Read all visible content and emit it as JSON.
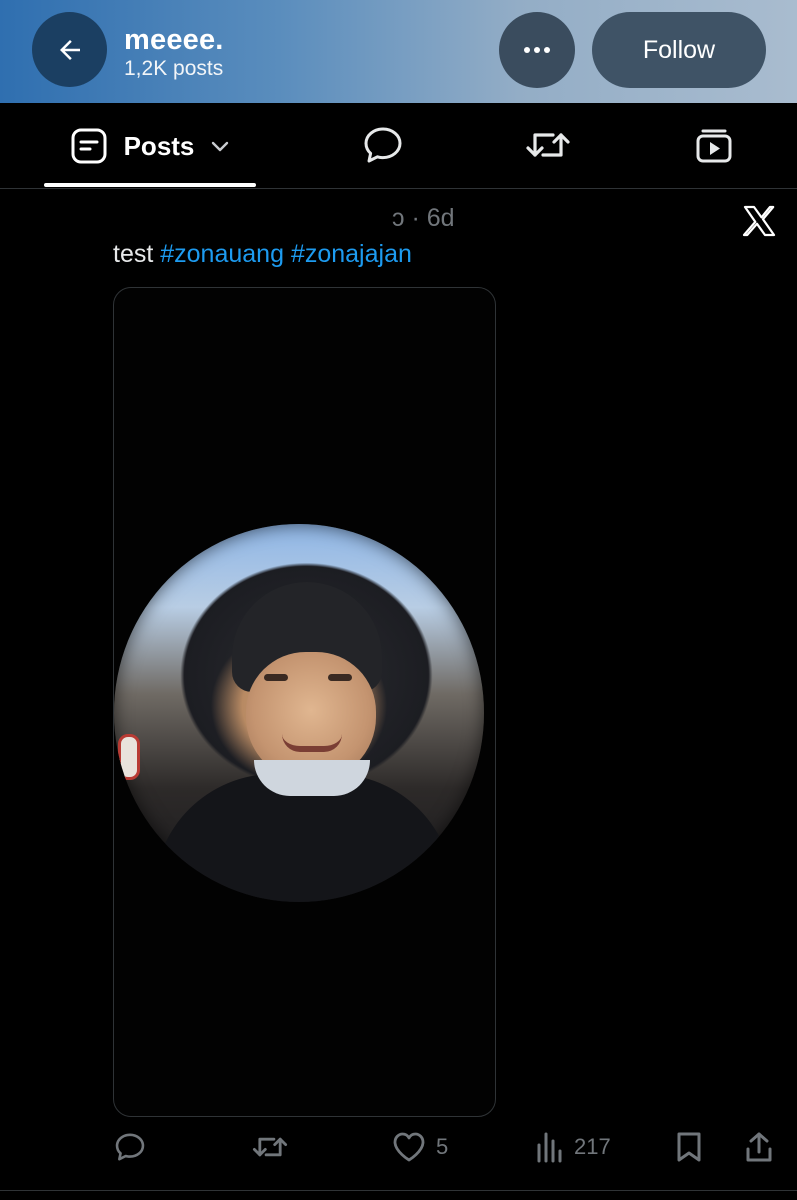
{
  "header": {
    "back_icon": "arrow-left-icon",
    "title": "meeee.",
    "subtitle": "1,2K posts",
    "more_icon": "more-horizontal-icon",
    "follow_label": "Follow"
  },
  "tabs": {
    "active_label": "Posts",
    "icons": [
      "posts-icon",
      "chevron-down-icon",
      "reply-icon",
      "repost-icon",
      "media-icon"
    ]
  },
  "post": {
    "meta": "ↄ · 6d",
    "text": "test",
    "hashtags": [
      "#zonauang",
      "#zonajajan"
    ],
    "badge_icon": "x-logo-icon"
  },
  "actions": {
    "likes": "5",
    "views": "217",
    "icons": [
      "reply-icon",
      "repost-icon",
      "heart-icon",
      "views-icon",
      "bookmark-icon",
      "share-icon"
    ]
  },
  "colors": {
    "accent": "#1d9bf0",
    "muted": "#71767b",
    "background": "#000000"
  }
}
